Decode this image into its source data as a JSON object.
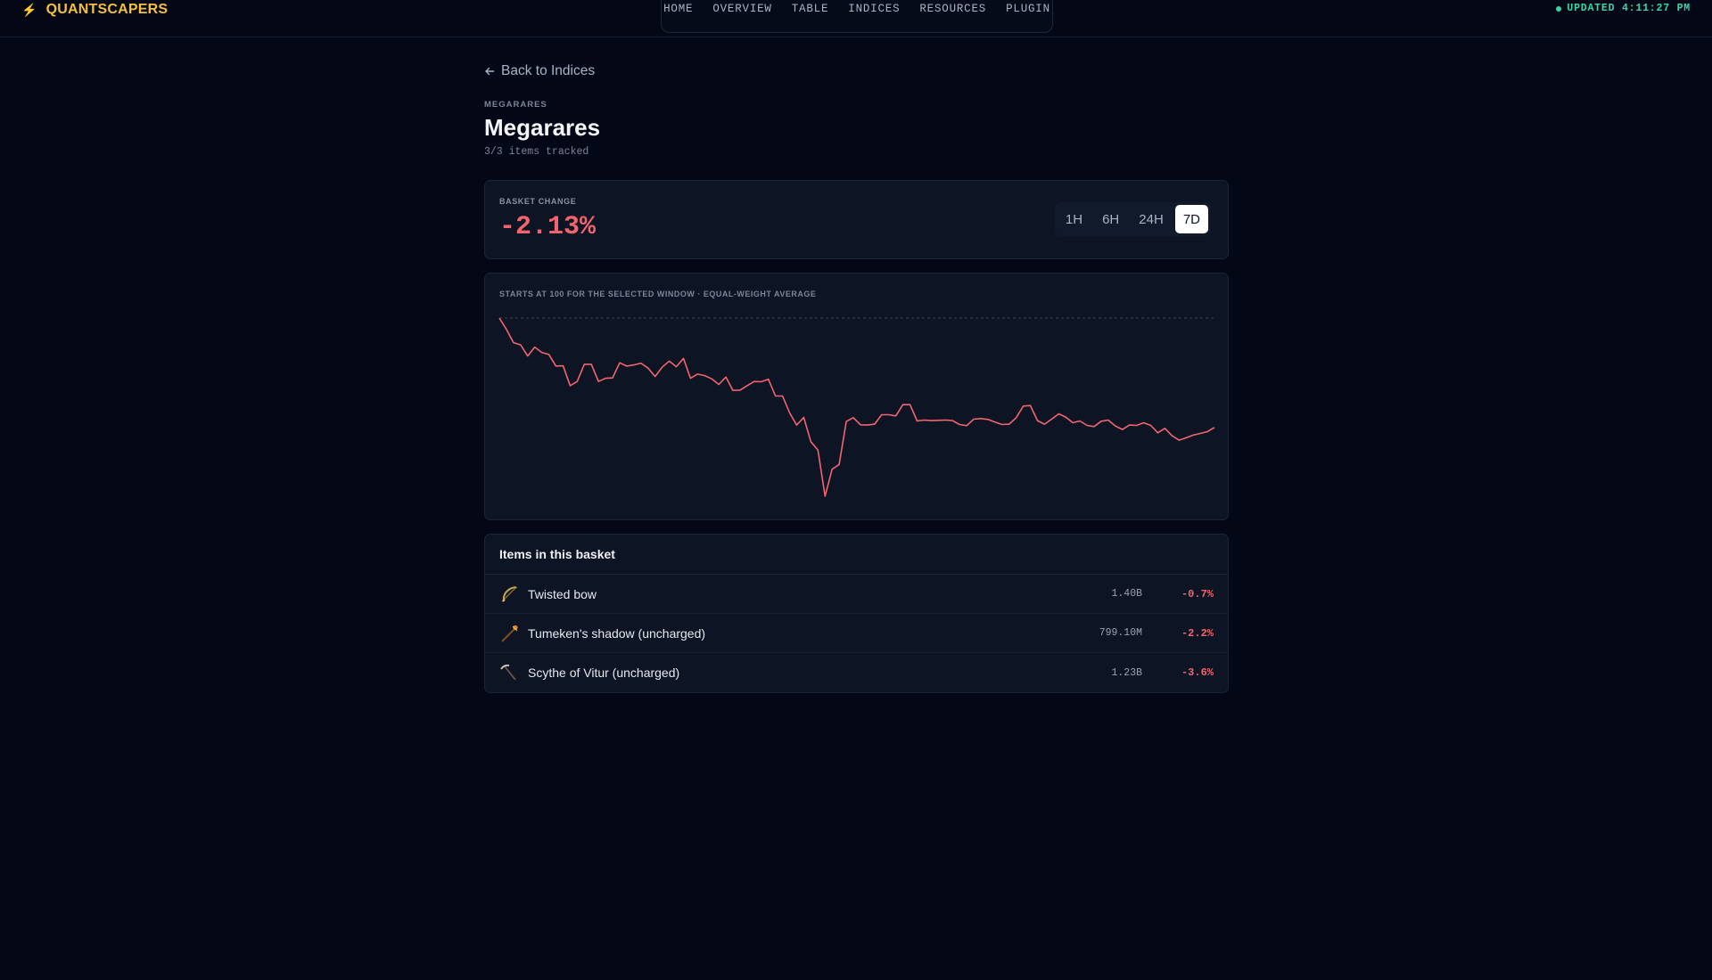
{
  "brand": {
    "name": "QUANTSCAPERS"
  },
  "nav": [
    "HOME",
    "OVERVIEW",
    "TABLE",
    "INDICES",
    "RESOURCES",
    "PLUGIN"
  ],
  "status": {
    "updated": "UPDATED 4:11:27 PM",
    "color": "#3ad6a6"
  },
  "page": {
    "back_label": "Back to Indices",
    "eyebrow": "MEGARARES",
    "title": "Megarares",
    "subtitle": "3/3 items tracked"
  },
  "basket": {
    "label": "BASKET CHANGE",
    "value": "-2.13%",
    "ranges": [
      "1H",
      "6H",
      "24H",
      "7D"
    ],
    "active_range": "7D"
  },
  "chart_note": "STARTS AT 100 FOR THE SELECTED WINDOW · EQUAL-WEIGHT AVERAGE",
  "chart_data": {
    "type": "line",
    "baseline": 100,
    "series": [
      {
        "color": "#f2656e",
        "values": [
          100,
          99.62,
          99.17,
          99.1,
          98.72,
          99.02,
          98.84,
          98.77,
          98.38,
          98.39,
          97.72,
          97.86,
          98.44,
          98.44,
          97.86,
          97.97,
          97.98,
          98.49,
          98.38,
          98.42,
          98.48,
          98.31,
          98.03,
          98.34,
          98.55,
          98.36,
          98.64,
          97.97,
          98.11,
          98.06,
          97.95,
          97.76,
          98.01,
          97.56,
          97.57,
          97.72,
          97.86,
          97.85,
          97.94,
          97.37,
          97.37,
          96.8,
          96.39,
          96.65,
          95.83,
          95.55,
          93.99,
          94.9,
          95.06,
          96.51,
          96.64,
          96.4,
          96.39,
          96.42,
          96.74,
          96.74,
          96.7,
          97.08,
          97.08,
          96.53,
          96.56,
          96.54,
          96.55,
          96.56,
          96.54,
          96.41,
          96.37,
          96.59,
          96.61,
          96.58,
          96.49,
          96.41,
          96.42,
          96.64,
          97.03,
          97.05,
          96.54,
          96.42,
          96.59,
          96.77,
          96.66,
          96.47,
          96.53,
          96.38,
          96.34,
          96.52,
          96.56,
          96.36,
          96.24,
          96.39,
          96.38,
          96.47,
          96.38,
          96.13,
          96.28,
          96.03,
          95.88,
          95.96,
          96.05,
          96.11,
          96.17,
          96.31
        ]
      }
    ]
  },
  "items": {
    "heading": "Items in this basket",
    "rows": [
      {
        "name": "Twisted bow",
        "price": "1.40B",
        "change": "-0.7%",
        "icon": "twisted-bow-icon"
      },
      {
        "name": "Tumeken's shadow (uncharged)",
        "price": "799.10M",
        "change": "-2.2%",
        "icon": "tumekens-shadow-icon"
      },
      {
        "name": "Scythe of Vitur (uncharged)",
        "price": "1.23B",
        "change": "-3.6%",
        "icon": "scythe-icon"
      }
    ]
  },
  "colors": {
    "accent": "#f5c13c",
    "negative": "#f2656e",
    "bg": "#040816",
    "card": "#0d1424"
  }
}
